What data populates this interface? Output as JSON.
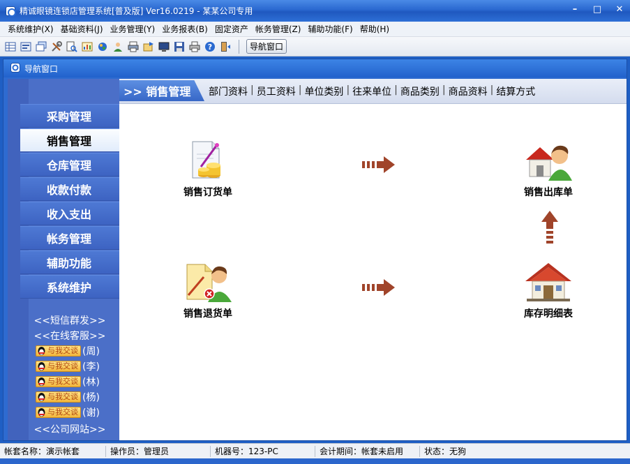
{
  "window": {
    "title": "精诚眼镜连锁店管理系统[普及版] Ver16.0219  -  某某公司专用",
    "minimize": "–",
    "maximize": "□",
    "close": "✕"
  },
  "menu": [
    "系统维护(X)",
    "基础资料(J)",
    "业务管理(Y)",
    "业务报表(B)",
    "固定资产",
    "帐务管理(Z)",
    "辅助功能(F)",
    "帮助(H)"
  ],
  "toolbar": {
    "nav_button": "导航窗口"
  },
  "nav_window": {
    "title": "导航窗口"
  },
  "sidebar": {
    "items": [
      "采购管理",
      "销售管理",
      "仓库管理",
      "收款付款",
      "收入支出",
      "帐务管理",
      "辅助功能",
      "系统维护"
    ],
    "active_index": 1,
    "links": {
      "sms": "<<短信群发>>",
      "service": "<<在线客服>>",
      "website": "<<公司网站>>"
    },
    "qq_badge": "与我交谈",
    "qq_contacts": [
      "(周)",
      "(李)",
      "(林)",
      "(杨)",
      "(谢)"
    ]
  },
  "content": {
    "section_title": ">> 销售管理",
    "header_links": [
      "部门资料",
      "员工资料",
      "单位类别",
      "往来单位",
      "商品类别",
      "商品资料",
      "结算方式"
    ],
    "flow": {
      "sales_order": "销售订货单",
      "sales_outbound": "销售出库单",
      "sales_return": "销售退货单",
      "inventory_detail": "库存明细表"
    }
  },
  "status": {
    "account": "帐套名称：演示帐套",
    "operator": "操作员：管理员",
    "machine": "机器号：123-PC",
    "period": "会计期间：帐套未启用",
    "state": "状态：无狗"
  },
  "colors": {
    "titlebar": "#2a68d0",
    "sidebar": "#4b6fc8",
    "arrow": "#a0442a"
  }
}
